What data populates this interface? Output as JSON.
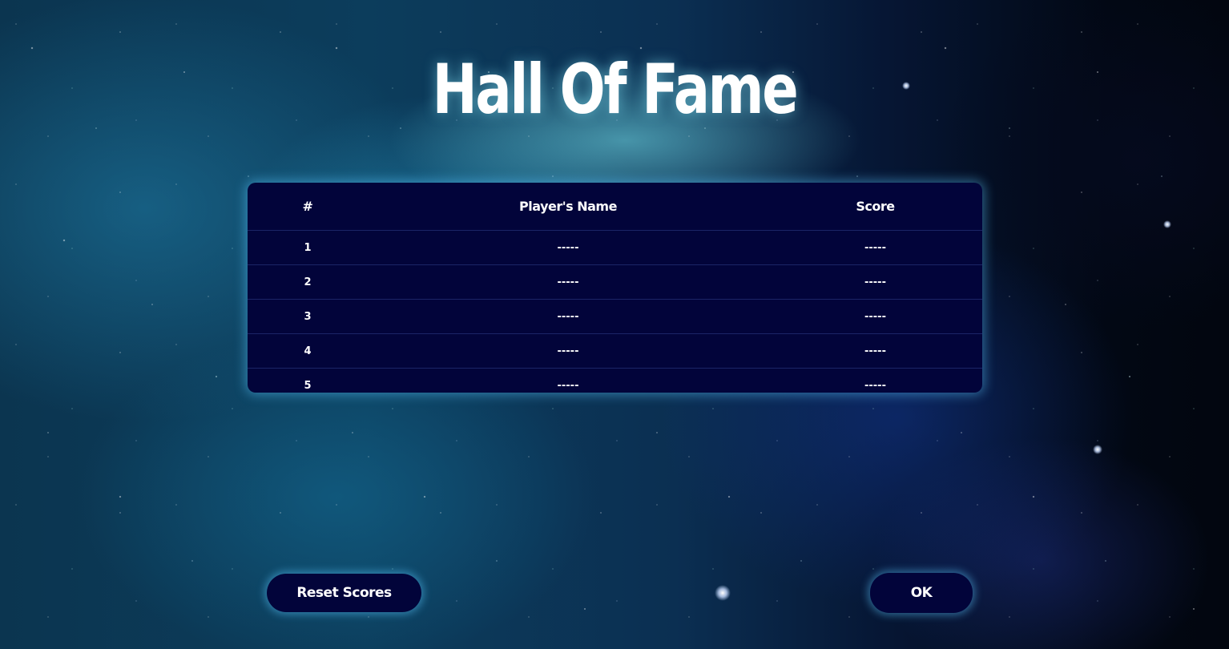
{
  "title": "Hall Of Fame",
  "table": {
    "headers": {
      "rank": "#",
      "name": "Player's Name",
      "score": "Score"
    },
    "rows": [
      {
        "rank": "1",
        "name": "-----",
        "score": "-----"
      },
      {
        "rank": "2",
        "name": "-----",
        "score": "-----"
      },
      {
        "rank": "3",
        "name": "-----",
        "score": "-----"
      },
      {
        "rank": "4",
        "name": "-----",
        "score": "-----"
      },
      {
        "rank": "5",
        "name": "-----",
        "score": "-----"
      }
    ]
  },
  "buttons": {
    "reset_label": "Reset Scores",
    "ok_label": "OK"
  },
  "colors": {
    "panel_bg": "#02043a",
    "glow": "#5ac8ff",
    "text": "#ffffff"
  }
}
